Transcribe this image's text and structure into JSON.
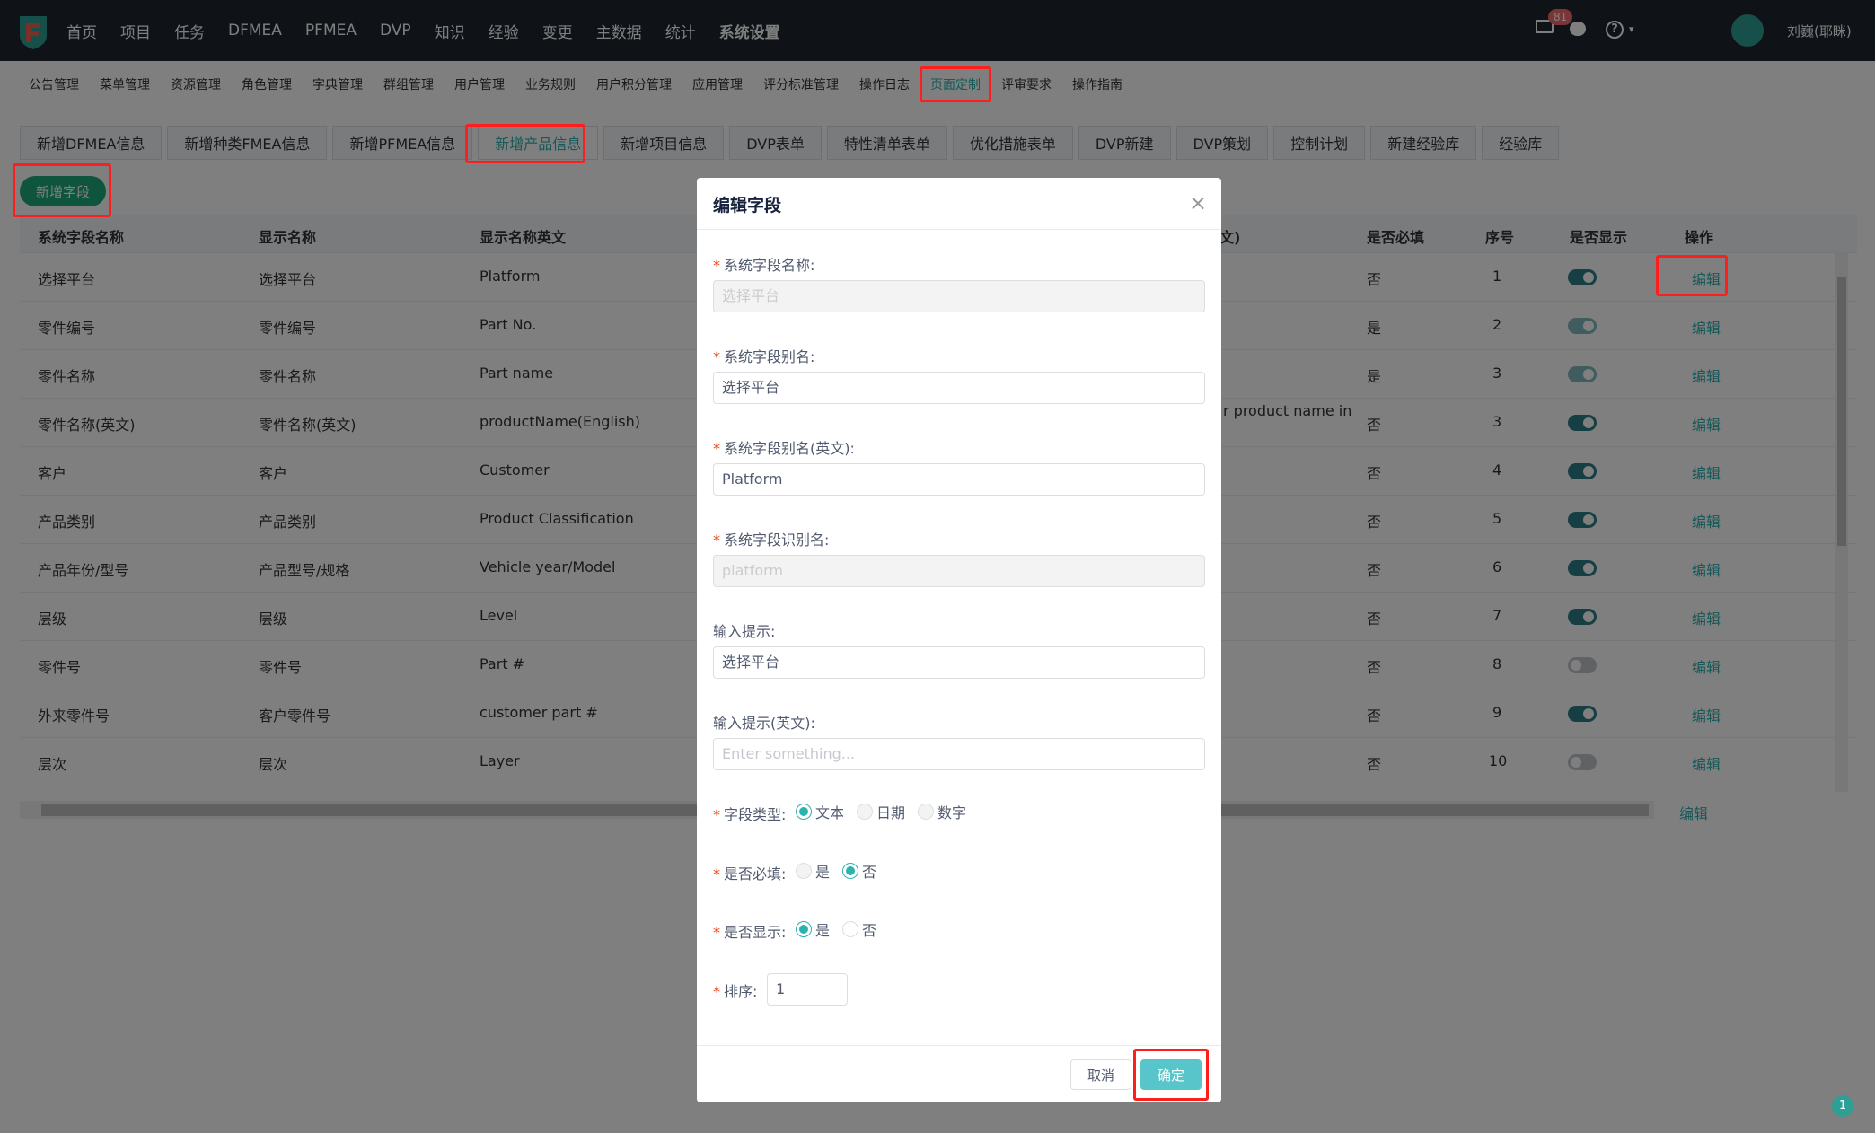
{
  "topbar": {
    "nav": [
      "首页",
      "项目",
      "任务",
      "DFMEA",
      "PFMEA",
      "DVP",
      "知识",
      "经验",
      "变更",
      "主数据",
      "统计",
      "系统设置"
    ],
    "mail_badge": "81",
    "help_caret": "▾",
    "user": "刘巍(耶眯)"
  },
  "submenu": [
    "公告管理",
    "菜单管理",
    "资源管理",
    "角色管理",
    "字典管理",
    "群组管理",
    "用户管理",
    "业务规则",
    "用户积分管理",
    "应用管理",
    "评分标准管理",
    "操作日志",
    "页面定制",
    "评审要求",
    "操作指南"
  ],
  "tabs": [
    "新增DFMEA信息",
    "新增种类FMEA信息",
    "新增PFMEA信息",
    "新增产品信息",
    "新增项目信息",
    "DVP表单",
    "特性清单表单",
    "优化措施表单",
    "DVP新建",
    "DVP策划",
    "控制计划",
    "新建经验库",
    "经验库"
  ],
  "add_field_button": "新增字段",
  "table": {
    "headers": [
      "系统字段名称",
      "显示名称",
      "显示名称英文",
      "文)",
      "是否必填",
      "序号",
      "是否显示",
      "操作"
    ],
    "edit_label": "编辑",
    "rows": [
      {
        "sys": "选择平台",
        "disp": "选择平台",
        "en": "Platform",
        "extra": "",
        "req": "否",
        "seq": "1"
      },
      {
        "sys": "零件编号",
        "disp": "零件编号",
        "en": "Part No.",
        "extra": "",
        "req": "是",
        "seq": "2"
      },
      {
        "sys": "零件名称",
        "disp": "零件名称",
        "en": "Part name",
        "extra": "",
        "req": "是",
        "seq": "3"
      },
      {
        "sys": "零件名称(英文)",
        "disp": "零件名称(英文)",
        "en": "productName(English)",
        "extra": "r product name in",
        "req": "否",
        "seq": "3"
      },
      {
        "sys": "客户",
        "disp": "客户",
        "en": "Customer",
        "extra": "",
        "req": "否",
        "seq": "4"
      },
      {
        "sys": "产品类别",
        "disp": "产品类别",
        "en": "Product Classification",
        "extra": "",
        "req": "否",
        "seq": "5"
      },
      {
        "sys": "产品年份/型号",
        "disp": "产品型号/规格",
        "en": "Vehicle year/Model",
        "extra": "",
        "req": "否",
        "seq": "6"
      },
      {
        "sys": "层级",
        "disp": "层级",
        "en": "Level",
        "extra": "",
        "req": "否",
        "seq": "7"
      },
      {
        "sys": "零件号",
        "disp": "零件号",
        "en": "Part #",
        "extra": "",
        "req": "否",
        "seq": "8"
      },
      {
        "sys": "外来零件号",
        "disp": "客户零件号",
        "en": "customer part #",
        "extra": "",
        "req": "否",
        "seq": "9"
      },
      {
        "sys": "层次",
        "disp": "层次",
        "en": "Layer",
        "extra": "",
        "req": "否",
        "seq": "10"
      }
    ]
  },
  "dialog": {
    "title": "编辑字段",
    "close": "×",
    "fields": {
      "sys_name_label": "系统字段名称:",
      "sys_name_value": "选择平台",
      "alias_label": "系统字段别名:",
      "alias_value": "选择平台",
      "alias_en_label": "系统字段别名(英文):",
      "alias_en_value": "Platform",
      "ident_label": "系统字段识别名:",
      "ident_value": "platform",
      "hint_label": "输入提示:",
      "hint_value": "选择平台",
      "hint_en_label": "输入提示(英文):",
      "hint_en_placeholder": "Enter something...",
      "type_label": "字段类型:",
      "type_options": [
        "文本",
        "日期",
        "数字"
      ],
      "required_label": "是否必填:",
      "required_options": [
        "是",
        "否"
      ],
      "visible_label": "是否显示:",
      "visible_options": [
        "是",
        "否"
      ],
      "order_label": "排序:",
      "order_value": "1"
    },
    "cancel": "取消",
    "ok": "确定"
  },
  "help_corner": "1"
}
